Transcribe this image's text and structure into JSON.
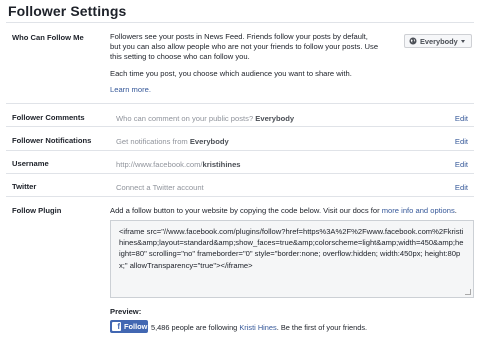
{
  "page_title": "Follower Settings",
  "who_can_follow": {
    "label": "Who Can Follow Me",
    "paragraph1": "Followers see your posts in News Feed. Friends follow your posts by default, but you can also allow people who are not your friends to follow your posts. Use this setting to choose who can follow you.",
    "paragraph2": "Each time you post, you choose which audience you want to share with.",
    "learn_more": "Learn more.",
    "audience_button": "Everybody",
    "audience_icon": "globe-icon",
    "caret_icon": "chevron-down-icon"
  },
  "rows": [
    {
      "label": "Follower Comments",
      "value_prefix": "Who can comment on your public posts? ",
      "value_bold": "Everybody",
      "edit": "Edit"
    },
    {
      "label": "Follower Notifications",
      "value_prefix": "Get notifications from ",
      "value_bold": "Everybody",
      "edit": "Edit"
    },
    {
      "label": "Username",
      "value_prefix": "http://www.facebook.com/",
      "value_bold": "kristihines",
      "edit": "Edit"
    },
    {
      "label": "Twitter",
      "value_prefix": "Connect a Twitter account",
      "value_bold": "",
      "edit": "Edit"
    }
  ],
  "follow_plugin": {
    "label": "Follow Plugin",
    "intro": "Add a follow button to your website by copying the code below. Visit our docs for ",
    "intro_link": "more info and options",
    "intro_end": ".",
    "code": "<iframe src=\"//www.facebook.com/plugins/follow?href=https%3A%2F%2Fwww.facebook.com%2Fkristihines&amp;layout=standard&amp;show_faces=true&amp;colorscheme=light&amp;width=450&amp;height=80\" scrolling=\"no\" frameborder=\"0\" style=\"border:none; overflow:hidden; width:450px; height:80px;\" allowTransparency=\"true\"></iframe>",
    "preview_label": "Preview:",
    "follow_button": "Follow",
    "follow_icon": "facebook-f-icon",
    "follow_text_prefix": "5,486 people are following ",
    "follow_text_link": "Kristi Hines",
    "follow_text_suffix": ". Be the first of your friends."
  },
  "colors": {
    "link": "#365899",
    "button": "#4267b2",
    "muted": "#90949c"
  }
}
